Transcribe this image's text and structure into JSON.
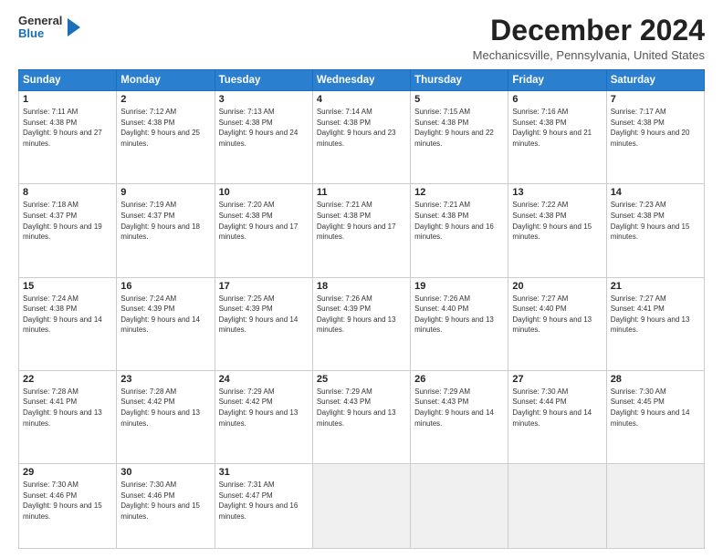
{
  "header": {
    "logo_general": "General",
    "logo_blue": "Blue",
    "title": "December 2024",
    "location": "Mechanicsville, Pennsylvania, United States"
  },
  "calendar": {
    "days_of_week": [
      "Sunday",
      "Monday",
      "Tuesday",
      "Wednesday",
      "Thursday",
      "Friday",
      "Saturday"
    ],
    "weeks": [
      [
        {
          "day": "1",
          "sunrise": "7:11 AM",
          "sunset": "4:38 PM",
          "daylight": "9 hours and 27 minutes."
        },
        {
          "day": "2",
          "sunrise": "7:12 AM",
          "sunset": "4:38 PM",
          "daylight": "9 hours and 25 minutes."
        },
        {
          "day": "3",
          "sunrise": "7:13 AM",
          "sunset": "4:38 PM",
          "daylight": "9 hours and 24 minutes."
        },
        {
          "day": "4",
          "sunrise": "7:14 AM",
          "sunset": "4:38 PM",
          "daylight": "9 hours and 23 minutes."
        },
        {
          "day": "5",
          "sunrise": "7:15 AM",
          "sunset": "4:38 PM",
          "daylight": "9 hours and 22 minutes."
        },
        {
          "day": "6",
          "sunrise": "7:16 AM",
          "sunset": "4:38 PM",
          "daylight": "9 hours and 21 minutes."
        },
        {
          "day": "7",
          "sunrise": "7:17 AM",
          "sunset": "4:38 PM",
          "daylight": "9 hours and 20 minutes."
        }
      ],
      [
        {
          "day": "8",
          "sunrise": "7:18 AM",
          "sunset": "4:37 PM",
          "daylight": "9 hours and 19 minutes."
        },
        {
          "day": "9",
          "sunrise": "7:19 AM",
          "sunset": "4:37 PM",
          "daylight": "9 hours and 18 minutes."
        },
        {
          "day": "10",
          "sunrise": "7:20 AM",
          "sunset": "4:38 PM",
          "daylight": "9 hours and 17 minutes."
        },
        {
          "day": "11",
          "sunrise": "7:21 AM",
          "sunset": "4:38 PM",
          "daylight": "9 hours and 17 minutes."
        },
        {
          "day": "12",
          "sunrise": "7:21 AM",
          "sunset": "4:38 PM",
          "daylight": "9 hours and 16 minutes."
        },
        {
          "day": "13",
          "sunrise": "7:22 AM",
          "sunset": "4:38 PM",
          "daylight": "9 hours and 15 minutes."
        },
        {
          "day": "14",
          "sunrise": "7:23 AM",
          "sunset": "4:38 PM",
          "daylight": "9 hours and 15 minutes."
        }
      ],
      [
        {
          "day": "15",
          "sunrise": "7:24 AM",
          "sunset": "4:38 PM",
          "daylight": "9 hours and 14 minutes."
        },
        {
          "day": "16",
          "sunrise": "7:24 AM",
          "sunset": "4:39 PM",
          "daylight": "9 hours and 14 minutes."
        },
        {
          "day": "17",
          "sunrise": "7:25 AM",
          "sunset": "4:39 PM",
          "daylight": "9 hours and 14 minutes."
        },
        {
          "day": "18",
          "sunrise": "7:26 AM",
          "sunset": "4:39 PM",
          "daylight": "9 hours and 13 minutes."
        },
        {
          "day": "19",
          "sunrise": "7:26 AM",
          "sunset": "4:40 PM",
          "daylight": "9 hours and 13 minutes."
        },
        {
          "day": "20",
          "sunrise": "7:27 AM",
          "sunset": "4:40 PM",
          "daylight": "9 hours and 13 minutes."
        },
        {
          "day": "21",
          "sunrise": "7:27 AM",
          "sunset": "4:41 PM",
          "daylight": "9 hours and 13 minutes."
        }
      ],
      [
        {
          "day": "22",
          "sunrise": "7:28 AM",
          "sunset": "4:41 PM",
          "daylight": "9 hours and 13 minutes."
        },
        {
          "day": "23",
          "sunrise": "7:28 AM",
          "sunset": "4:42 PM",
          "daylight": "9 hours and 13 minutes."
        },
        {
          "day": "24",
          "sunrise": "7:29 AM",
          "sunset": "4:42 PM",
          "daylight": "9 hours and 13 minutes."
        },
        {
          "day": "25",
          "sunrise": "7:29 AM",
          "sunset": "4:43 PM",
          "daylight": "9 hours and 13 minutes."
        },
        {
          "day": "26",
          "sunrise": "7:29 AM",
          "sunset": "4:43 PM",
          "daylight": "9 hours and 14 minutes."
        },
        {
          "day": "27",
          "sunrise": "7:30 AM",
          "sunset": "4:44 PM",
          "daylight": "9 hours and 14 minutes."
        },
        {
          "day": "28",
          "sunrise": "7:30 AM",
          "sunset": "4:45 PM",
          "daylight": "9 hours and 14 minutes."
        }
      ],
      [
        {
          "day": "29",
          "sunrise": "7:30 AM",
          "sunset": "4:46 PM",
          "daylight": "9 hours and 15 minutes."
        },
        {
          "day": "30",
          "sunrise": "7:30 AM",
          "sunset": "4:46 PM",
          "daylight": "9 hours and 15 minutes."
        },
        {
          "day": "31",
          "sunrise": "7:31 AM",
          "sunset": "4:47 PM",
          "daylight": "9 hours and 16 minutes."
        },
        null,
        null,
        null,
        null
      ]
    ]
  }
}
